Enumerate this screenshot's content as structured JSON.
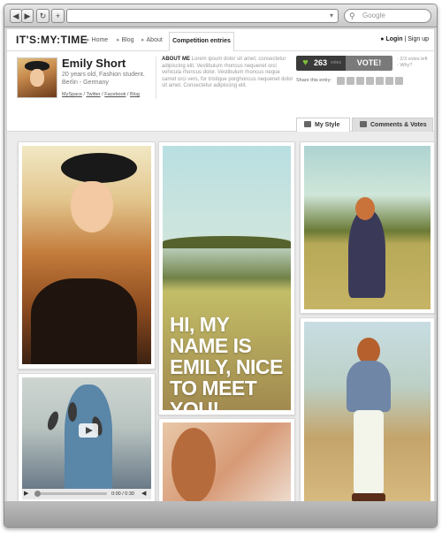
{
  "browser": {
    "back_icon": "◀",
    "forward_icon": "▶",
    "reload_icon": "↻",
    "new_tab_icon": "+",
    "address_value": "",
    "search_placeholder": "Google"
  },
  "site": {
    "logo": "IT'S:MY:TIME",
    "nav": [
      {
        "label": "Home"
      },
      {
        "label": "Blog"
      },
      {
        "label": "About"
      }
    ],
    "nav_active": "Competition entries",
    "login": "Login",
    "signup": "Sign up"
  },
  "profile": {
    "name": "Emily Short",
    "description": "20 years old, Fashion student. Berlin - Germany",
    "links": [
      "MySpace",
      "Twitter",
      "Facebook",
      "Blog"
    ],
    "about_title": "ABOUT ME",
    "about_text": "Lorem ipsum dolor sit amet, consectetur adipiscing elit. Vestibulum rhoncus nequenet orci vehicula rhoncus dolor. Vestibulum rhoncus neque samet orci vers, for tristique porghoncus nequenet dolor sit amet. Consectetur adipiscing elit."
  },
  "votes": {
    "count": "263",
    "label": "votes",
    "button": "VOTE!",
    "note_line1": "- 2/3 votes left",
    "note_line2": "- Why?"
  },
  "share": {
    "label": "Share this entry:"
  },
  "tabs": [
    {
      "label": "My Style"
    },
    {
      "label": "Comments & Votes"
    }
  ],
  "gallery": {
    "slogan": "HI, MY NAME IS EMILY, NICE TO MEET YOU!",
    "video": {
      "time": "0:00 / 0:30",
      "progress": 0.0
    }
  }
}
